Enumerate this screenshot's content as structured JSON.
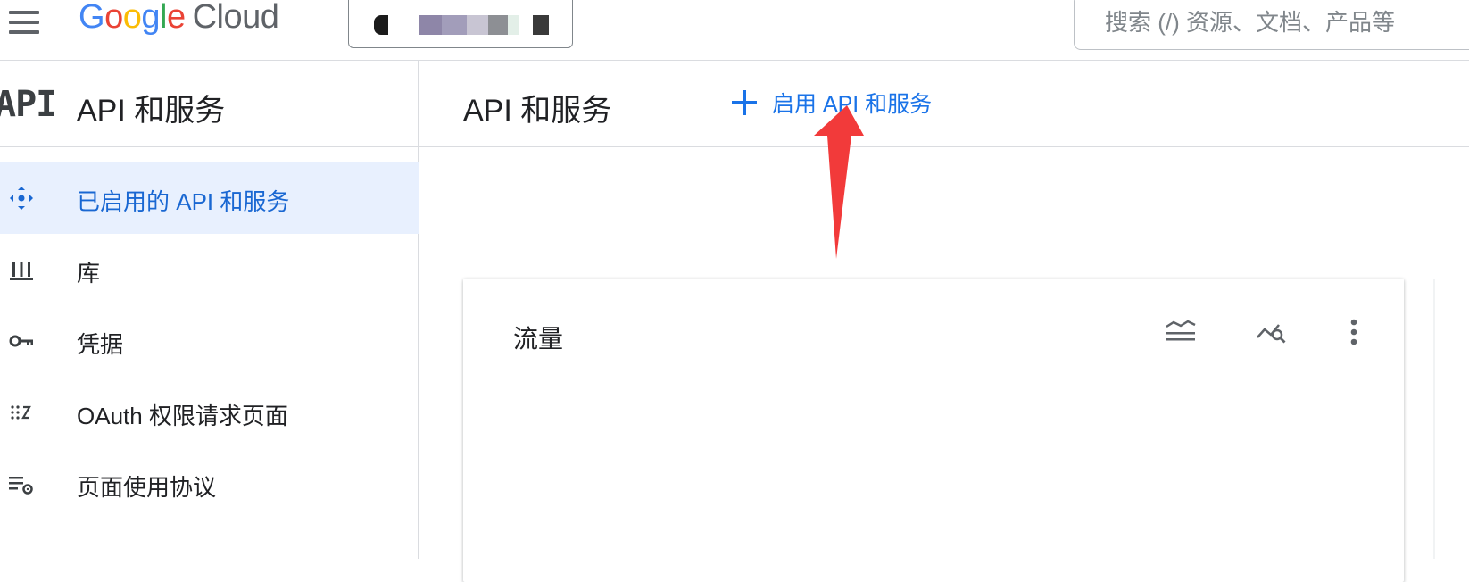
{
  "app": {
    "logo_google": "Google",
    "logo_cloud": "Cloud",
    "logo_colors": [
      "#4285F4",
      "#EA4335",
      "#FBBC05",
      "#4285F4",
      "#34A853",
      "#EA4335"
    ]
  },
  "search": {
    "placeholder": "搜索 (/) 资源、文档、产品等"
  },
  "sidebar": {
    "icon_text": "API",
    "title": "API 和服务",
    "items": [
      {
        "label": "已启用的 API 和服务",
        "icon": "hub-icon",
        "active": true
      },
      {
        "label": "库",
        "icon": "library-icon",
        "active": false
      },
      {
        "label": "凭据",
        "icon": "key-icon",
        "active": false
      },
      {
        "label": "OAuth 权限请求页面",
        "icon": "consent-icon",
        "active": false
      },
      {
        "label": "页面使用协议",
        "icon": "settings-list-icon",
        "active": false
      }
    ]
  },
  "main": {
    "title": "API 和服务",
    "enable_button": "启用 API 和服务"
  },
  "card": {
    "title": "流量",
    "icons": [
      "legend-icon",
      "explore-chart-icon",
      "more-vert-icon"
    ]
  },
  "colors": {
    "accent": "#1a73e8",
    "active_bg": "#e8f0fe",
    "annotation_arrow": "#f23a3a"
  }
}
